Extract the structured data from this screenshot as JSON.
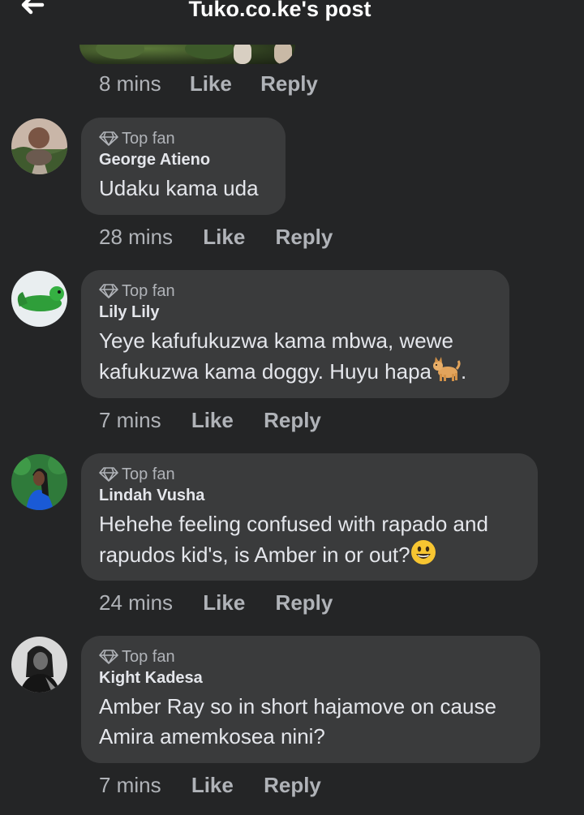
{
  "header": {
    "title": "Tuko.co.ke's post",
    "back_icon": "back-arrow-icon"
  },
  "previous": {
    "time": "8 mins",
    "like_label": "Like",
    "reply_label": "Reply"
  },
  "comments": [
    {
      "badge": "Top fan",
      "author": "George Atieno",
      "text": "Udaku kama uda",
      "time": "28 mins",
      "like_label": "Like",
      "reply_label": "Reply"
    },
    {
      "badge": "Top fan",
      "author": "Lily Lily",
      "text_line1": "Yeye kafufukuzwa kama mbwa, wewe",
      "text_line2": "kafukuzwa kama doggy. Huyu hapa",
      "text_end": ".",
      "emoji": "dog-emoji",
      "time": "7 mins",
      "like_label": "Like",
      "reply_label": "Reply"
    },
    {
      "badge": "Top fan",
      "author": "Lindah Vusha",
      "text_line1": "Hehehe feeling confused with rapado and",
      "text_line2": "rapudos kid's, is Amber in or out?",
      "emoji": "grinning-face-emoji",
      "time": "24 mins",
      "like_label": "Like",
      "reply_label": "Reply"
    },
    {
      "badge": "Top fan",
      "author": "Kight Kadesa",
      "text_line1": "Amber Ray so in short hajamove on cause",
      "text_line2": "Amira amemkosea nini?",
      "time": "7 mins",
      "like_label": "Like",
      "reply_label": "Reply"
    }
  ],
  "colors": {
    "background": "#242526",
    "bubble": "#3a3b3c",
    "text": "#e4e6eb",
    "muted": "#b0b3b8"
  }
}
